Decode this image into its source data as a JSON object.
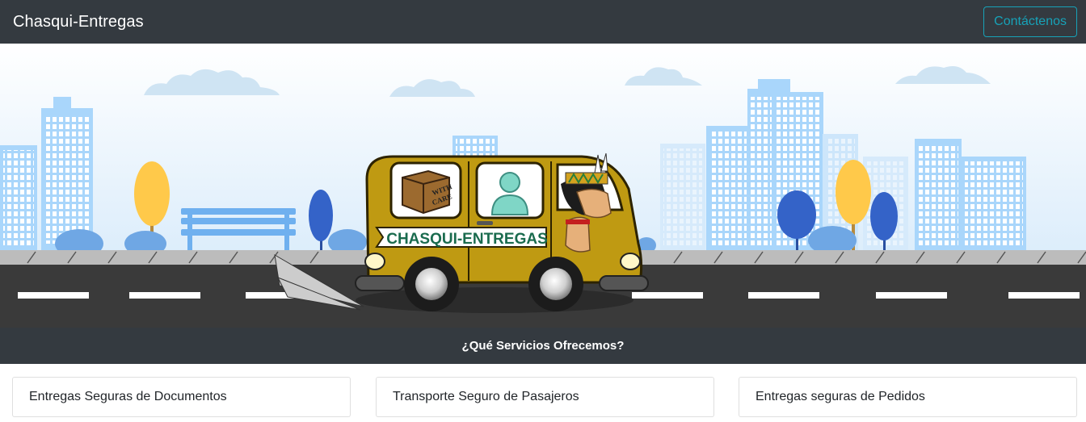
{
  "navbar": {
    "brand": "Chasqui-Entregas",
    "contact_label": "Contáctenos",
    "background": "#343a40",
    "accent": "#17a2b8"
  },
  "hero": {
    "van_sign": "CHASQUI-ENTREGAS",
    "box_label_line1": "WITH",
    "box_label_line2": "CARE",
    "sky_color": "#e9f4fc",
    "building_color": "#a9d6fb",
    "road_color": "#3a3a3a",
    "van_color": "#bf9a12"
  },
  "services": {
    "title": "¿Qué Servicios Ofrecemos?",
    "items": [
      {
        "label": "Entregas Seguras de Documentos"
      },
      {
        "label": "Transporte Seguro de Pasajeros"
      },
      {
        "label": "Entregas seguras de Pedidos"
      }
    ]
  }
}
